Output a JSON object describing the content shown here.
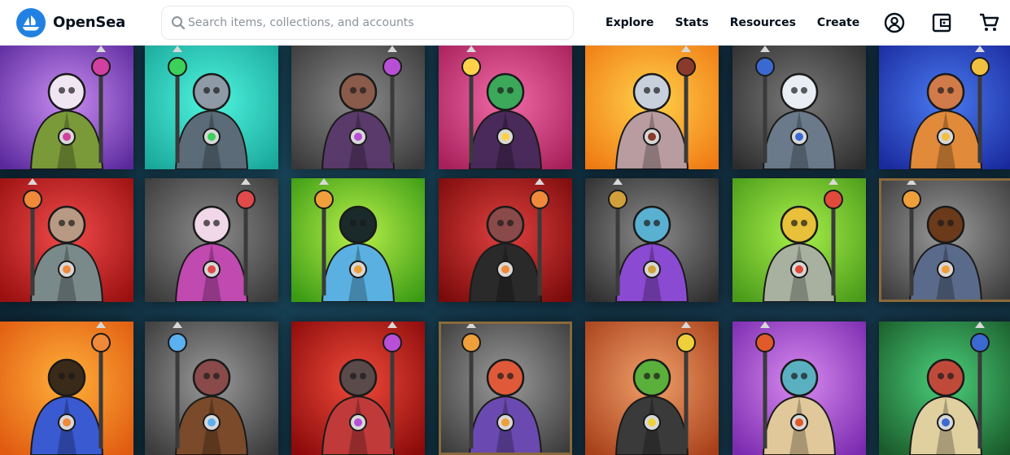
{
  "header": {
    "brand": "OpenSea",
    "search_placeholder": "Search items, collections, and accounts",
    "search_value": "",
    "nav": [
      "Explore",
      "Stats",
      "Resources",
      "Create"
    ],
    "icons": [
      "account-icon",
      "wallet-icon",
      "cart-icon"
    ]
  },
  "colors": {
    "brand_blue": "#2081e2",
    "text_dark": "#04111d"
  },
  "tiles": [
    {
      "bg": [
        "#c98cf0",
        "#5b2a9e"
      ],
      "head": "#efe6f2",
      "body": "#7a9a3a",
      "accent": "#d13fa0"
    },
    {
      "bg": [
        "#4ff5df",
        "#1aa89b"
      ],
      "head": "#8e9aa6",
      "body": "#5b6b78",
      "accent": "#3bd15a"
    },
    {
      "bg": [
        "#8a8a8a",
        "#3a3a3a"
      ],
      "head": "#8a5a4a",
      "body": "#5a3a6a",
      "accent": "#b84fd6"
    },
    {
      "bg": [
        "#f06aa6",
        "#a8205a"
      ],
      "head": "#3ca85a",
      "body": "#4a2a5a",
      "accent": "#ffd24a"
    },
    {
      "bg": [
        "#ffd24a",
        "#f07a14"
      ],
      "head": "#c8d0dc",
      "body": "#b89ca0",
      "accent": "#8a3a2a"
    },
    {
      "bg": [
        "#7a7a7a",
        "#2e2e2e"
      ],
      "head": "#e8eef4",
      "body": "#6a7a8a",
      "accent": "#3a6ad1"
    },
    {
      "bg": [
        "#4a7af0",
        "#1a2a9e"
      ],
      "head": "#d17a4a",
      "body": "#e08a3a",
      "accent": "#f0c040"
    },
    {
      "bg": [
        "#f04a4a",
        "#9a1010"
      ],
      "head": "#b89a84",
      "body": "#7a8a8a",
      "accent": "#f08a3a"
    },
    {
      "bg": [
        "#8a8a8a",
        "#3a3a3a"
      ],
      "head": "#f0d8e8",
      "body": "#c04ab0",
      "accent": "#e04a4a"
    },
    {
      "bg": [
        "#b8f04a",
        "#3a9a14"
      ],
      "head": "#1a2a2a",
      "body": "#5ab0e0",
      "accent": "#f0a03a"
    },
    {
      "bg": [
        "#e04040",
        "#7a0a0a"
      ],
      "head": "#8a4a4a",
      "body": "#2a2a2a",
      "accent": "#f08a3a"
    },
    {
      "bg": [
        "#8a8a8a",
        "#2e2e2e"
      ],
      "head": "#5ab0d1",
      "body": "#8a4ad1",
      "accent": "#d1a03a"
    },
    {
      "bg": [
        "#a8f04a",
        "#4a9a1a"
      ],
      "head": "#e8c03a",
      "body": "#a8b0a0",
      "accent": "#e04a3a"
    },
    {
      "bg": [
        "#9a9a9a",
        "#3a3a3a"
      ],
      "head": "#6a3a1a",
      "body": "#5a6a8a",
      "accent": "#f0a03a",
      "frame": true
    },
    {
      "bg": [
        "#ffb03a",
        "#e05a10"
      ],
      "head": "#3a2a1a",
      "body": "#3a5ad1",
      "accent": "#f08a3a"
    },
    {
      "bg": [
        "#9a9a9a",
        "#3a3a3a"
      ],
      "head": "#8a4a4a",
      "body": "#7a4a2a",
      "accent": "#5ab0f0"
    },
    {
      "bg": [
        "#f04a3a",
        "#8a0a0a"
      ],
      "head": "#5a4a4a",
      "body": "#c03a3a",
      "accent": "#b84fd6"
    },
    {
      "bg": [
        "#9a9a9a",
        "#3a3a3a"
      ],
      "head": "#e05a3a",
      "body": "#6a4ab0",
      "accent": "#f0a03a",
      "frame": true
    },
    {
      "bg": [
        "#f0a06a",
        "#a8401a"
      ],
      "head": "#5ab03a",
      "body": "#3a3a3a",
      "accent": "#f0d03a"
    },
    {
      "bg": [
        "#d88af0",
        "#7a2aae"
      ],
      "head": "#5ab0c0",
      "body": "#e0c89a",
      "accent": "#e05a2a"
    },
    {
      "bg": [
        "#4ad07a",
        "#1a5a2a"
      ],
      "head": "#c04a3a",
      "body": "#e0d0a0",
      "accent": "#3a6ad1"
    }
  ]
}
